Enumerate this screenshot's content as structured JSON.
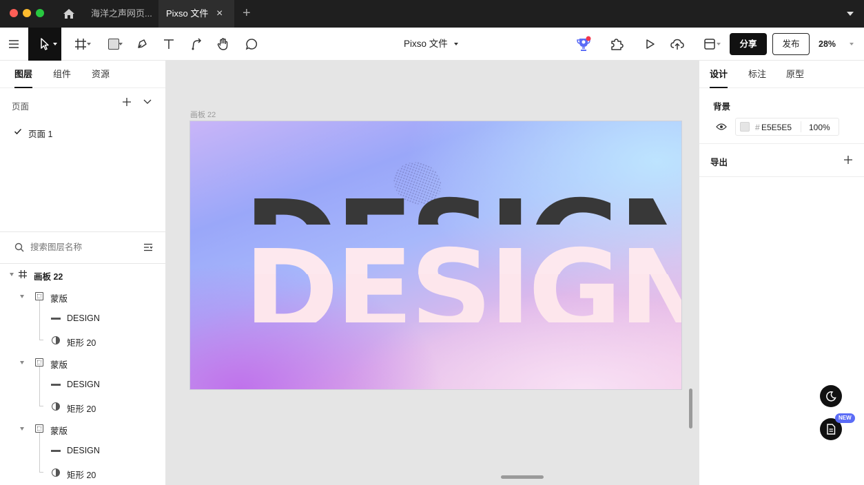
{
  "tabs": {
    "home_icon": "home-icon",
    "tab1": "海洋之声网页...",
    "tab2": "Pixso 文件"
  },
  "toolbar": {
    "file_title": "Pixso 文件",
    "share_label": "分享",
    "publish_label": "发布",
    "zoom": "28%"
  },
  "left_panel": {
    "tabs": [
      "图层",
      "组件",
      "资源"
    ],
    "pages_label": "页面",
    "pages": [
      {
        "name": "页面 1",
        "checked": true
      }
    ],
    "search_placeholder": "搜索图层名称",
    "layers": [
      {
        "name": "画板 22",
        "type": "frame",
        "level": 0
      },
      {
        "name": "蒙版",
        "type": "mask",
        "level": 1
      },
      {
        "name": "DESIGN",
        "type": "text",
        "level": 2
      },
      {
        "name": "矩形 20",
        "type": "rect-mask",
        "level": 2
      },
      {
        "name": "蒙版",
        "type": "mask",
        "level": 1
      },
      {
        "name": "DESIGN",
        "type": "text",
        "level": 2
      },
      {
        "name": "矩形 20",
        "type": "rect-mask",
        "level": 2
      },
      {
        "name": "蒙版",
        "type": "mask",
        "level": 1
      },
      {
        "name": "DESIGN",
        "type": "text",
        "level": 2
      },
      {
        "name": "矩形 20",
        "type": "rect-mask",
        "level": 2
      }
    ]
  },
  "canvas": {
    "artboard_label": "画板 22",
    "design_word": "DESIGN",
    "colors": {
      "dark_text": "#383838",
      "light_text": "#fde8ee",
      "bg": "#e5e5e5"
    }
  },
  "right_panel": {
    "tabs": [
      "设计",
      "标注",
      "原型"
    ],
    "background_label": "背景",
    "hash": "#",
    "bg_color": "E5E5E5",
    "bg_opacity": "100%",
    "export_label": "导出",
    "new_badge": "NEW"
  }
}
